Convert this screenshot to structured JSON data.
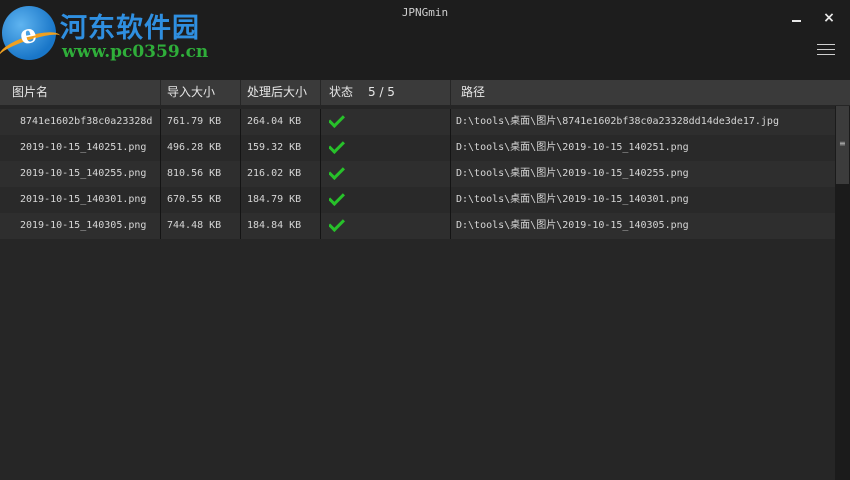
{
  "branding": {
    "name": "河东软件园",
    "url": "www.pc0359.cn"
  },
  "window": {
    "title": "JPNGmin",
    "minimize": "–",
    "close": "×"
  },
  "columns": {
    "name": "图片名",
    "input_size": "导入大小",
    "output_size": "处理后大小",
    "status": "状态",
    "path": "路径"
  },
  "status_count": "5 / 5",
  "rows": [
    {
      "name": "8741e1602bf38c0a23328d",
      "input_size": "761.79 KB",
      "output_size": "264.04 KB",
      "path": "D:\\tools\\桌面\\图片\\8741e1602bf38c0a23328dd14de3de17.jpg"
    },
    {
      "name": "2019-10-15_140251.png",
      "input_size": "496.28 KB",
      "output_size": "159.32 KB",
      "path": "D:\\tools\\桌面\\图片\\2019-10-15_140251.png"
    },
    {
      "name": "2019-10-15_140255.png",
      "input_size": "810.56 KB",
      "output_size": "216.02 KB",
      "path": "D:\\tools\\桌面\\图片\\2019-10-15_140255.png"
    },
    {
      "name": "2019-10-15_140301.png",
      "input_size": "670.55 KB",
      "output_size": "184.79 KB",
      "path": "D:\\tools\\桌面\\图片\\2019-10-15_140301.png"
    },
    {
      "name": "2019-10-15_140305.png",
      "input_size": "744.48 KB",
      "output_size": "184.84 KB",
      "path": "D:\\tools\\桌面\\图片\\2019-10-15_140305.png"
    }
  ],
  "colors": {
    "background": "#262626",
    "header": "#3a3a3a",
    "check": "#27c12a",
    "brand_blue": "#2f8fe0",
    "brand_green": "#2fae3a"
  },
  "icons": {
    "status_done": "check-icon",
    "menu": "hamburger-menu-icon"
  }
}
